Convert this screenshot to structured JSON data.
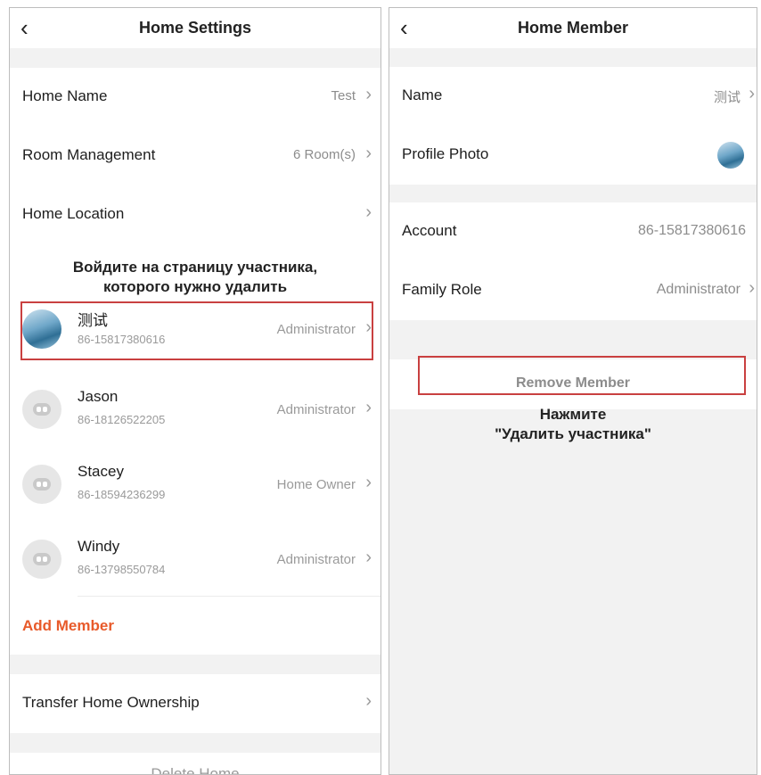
{
  "left": {
    "back_icon": "‹",
    "title": "Home Settings",
    "rows": [
      {
        "label": "Home Name",
        "value": "Test"
      },
      {
        "label": "Room Management",
        "value": "6 Room(s)"
      },
      {
        "label": "Home Location",
        "value": ""
      }
    ],
    "annotation": [
      "Войдите на страницу участника,",
      "которого нужно удалить"
    ],
    "members": [
      {
        "name": "测试",
        "phone": "86-15817380616",
        "role": "Administrator",
        "avatar": "photo"
      },
      {
        "name": "Jason",
        "phone": "86-18126522205",
        "role": "Administrator",
        "avatar": "robot"
      },
      {
        "name": "Stacey",
        "phone": "86-18594236299",
        "role": "Home Owner",
        "avatar": "robot"
      },
      {
        "name": "Windy",
        "phone": "86-13798550784",
        "role": "Administrator",
        "avatar": "robot"
      }
    ],
    "add_member": "Add Member",
    "transfer": "Transfer Home Ownership",
    "delete_home": "Delete Home",
    "colors": {
      "accent": "#e85a2a",
      "highlight": "#c94040"
    }
  },
  "right": {
    "back_icon": "‹",
    "title": "Home Member",
    "rows": [
      {
        "label": "Name",
        "value": "测试"
      },
      {
        "label": "Profile Photo",
        "value": ""
      },
      {
        "label": "Account",
        "value": "86-15817380616"
      },
      {
        "label": "Family Role",
        "value": "Administrator"
      }
    ],
    "remove_member": "Remove Member",
    "annotation": [
      "Нажмите",
      "\"Удалить участника\""
    ]
  },
  "chevron": "›"
}
